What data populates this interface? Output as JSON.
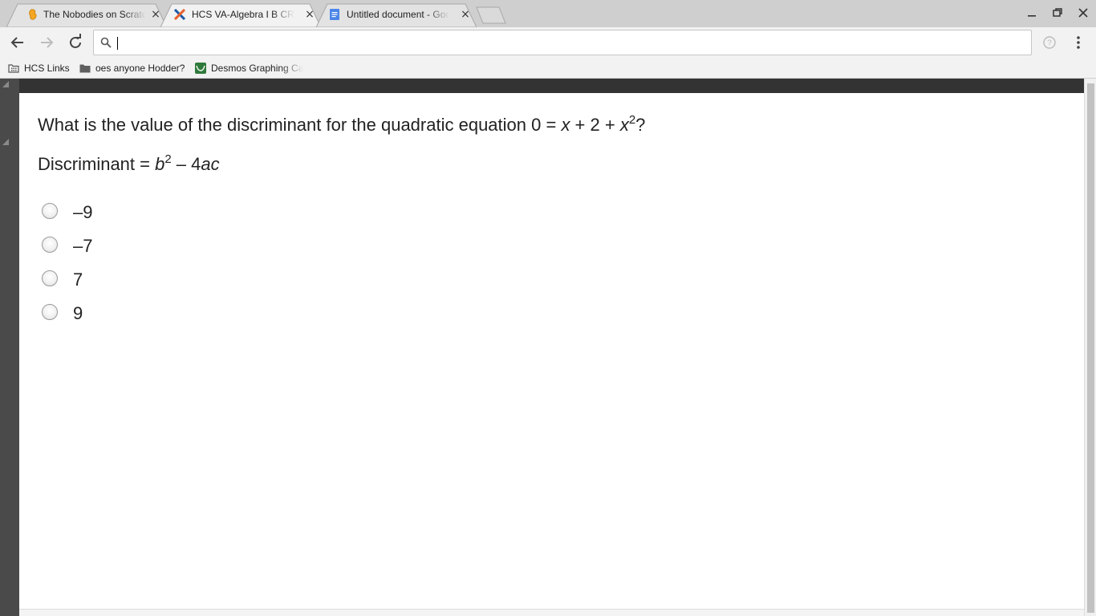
{
  "browser": {
    "tabs": [
      {
        "title": "The Nobodies on Scratch",
        "icon": "scratch-icon",
        "close": "×"
      },
      {
        "title": "HCS VA-Algebra I B CR",
        "icon": "edgenuity-icon",
        "close": "×"
      },
      {
        "title": "Untitled document - Google Docs",
        "icon": "google-docs-icon",
        "close": "×"
      }
    ],
    "omnibox": {
      "value": "",
      "placeholder": ""
    },
    "bookmarks": [
      {
        "label": "HCS Links",
        "icon": "apps-folder-icon"
      },
      {
        "label": "oes anyone Hodder?",
        "icon": "folder-icon"
      },
      {
        "label": "Desmos Graphing Ca",
        "icon": "desmos-icon"
      }
    ]
  },
  "question": {
    "prefix": "What is the value of the discriminant for the quadratic equation 0 = ",
    "x1": "x",
    "mid": " + 2 + ",
    "x2": "x",
    "exp": "2",
    "suffix": "?"
  },
  "formula": {
    "prefix": "Discriminant = ",
    "b": "b",
    "exp": "2",
    "mid": " – 4",
    "ac": "ac"
  },
  "choices": [
    "–9",
    "–7",
    "7",
    "9"
  ]
}
